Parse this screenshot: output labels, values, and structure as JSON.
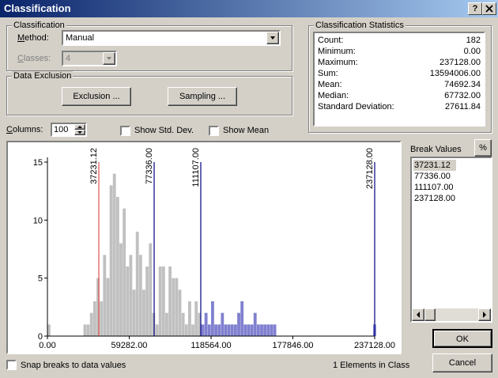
{
  "window": {
    "title": "Classification",
    "help_btn": "?",
    "close_btn": "X"
  },
  "classification": {
    "group_label": "Classification",
    "method_label": "Method:",
    "method_value": "Manual",
    "classes_label": "Classes:",
    "classes_value": "4"
  },
  "exclusion": {
    "group_label": "Data Exclusion",
    "exclusion_btn": "Exclusion ...",
    "sampling_btn": "Sampling ..."
  },
  "stats": {
    "group_label": "Classification Statistics",
    "rows": [
      {
        "label": "Count:",
        "value": "182"
      },
      {
        "label": "Minimum:",
        "value": "0.00"
      },
      {
        "label": "Maximum:",
        "value": "237128.00"
      },
      {
        "label": "Sum:",
        "value": "13594006.00"
      },
      {
        "label": "Mean:",
        "value": "74692.34"
      },
      {
        "label": "Median:",
        "value": "67732.00"
      },
      {
        "label": "Standard Deviation:",
        "value": "27611.84"
      }
    ]
  },
  "columns": {
    "label": "Columns:",
    "value": "100"
  },
  "show_std_dev": {
    "label": "Show Std. Dev.",
    "checked": false
  },
  "show_mean": {
    "label": "Show Mean",
    "checked": false
  },
  "break_values": {
    "label": "Break Values",
    "pct_btn": "%",
    "items": [
      "37231.12",
      "77336.00",
      "111107.00",
      "237128.00"
    ],
    "selected_index": 0
  },
  "ok_btn": "OK",
  "cancel_btn": "Cancel",
  "snap": {
    "label": "Snap breaks to data values",
    "checked": false
  },
  "elements_in_class": "1 Elements in Class",
  "chart_data": {
    "type": "bar",
    "xlim": [
      0,
      237128
    ],
    "ylim": [
      0,
      15
    ],
    "x_ticks": [
      "0.00",
      "59282.00",
      "118564.00",
      "177846.00",
      "237128.00"
    ],
    "y_ticks": [
      "0",
      "5",
      "10",
      "15"
    ],
    "bin_width": 2371.28,
    "bin_starts": [
      0,
      26086,
      28457,
      30828,
      33200,
      35571,
      37942,
      40313,
      42684,
      45055,
      47426,
      49797,
      52169,
      54540,
      56911,
      59282,
      61653,
      64024,
      66395,
      68766,
      71137,
      73508,
      75880,
      78251,
      80622,
      82993,
      85364,
      87735,
      90106,
      92477,
      94849,
      97220,
      99591,
      101962,
      104333,
      106704,
      109075,
      111446,
      113818,
      116189,
      118560,
      120931,
      123302,
      125673,
      128044,
      130415,
      132787,
      135158,
      137529,
      139900,
      142271,
      144642,
      147013,
      149384,
      151756,
      154127,
      156498,
      158869,
      161240,
      163611,
      235957
    ],
    "counts": [
      1,
      1,
      1,
      2,
      3,
      5,
      3,
      7,
      5,
      13,
      14,
      12,
      8,
      11,
      6,
      7,
      4,
      9,
      7,
      4,
      6,
      8,
      2,
      1,
      6,
      6,
      2,
      6,
      5,
      5,
      4,
      2,
      1,
      3,
      1,
      3,
      2,
      1,
      2,
      1,
      3,
      1,
      1,
      2,
      1,
      1,
      1,
      1,
      2,
      3,
      1,
      1,
      1,
      2,
      1,
      1,
      1,
      1,
      1,
      1,
      1
    ],
    "breaks": [
      37231.12,
      77336.0,
      111107.0,
      237128.0
    ],
    "break_labels": [
      "37231.12",
      "77336.00",
      "111107.00",
      "237128.00"
    ],
    "colors": {
      "bar": "#c0c0c0",
      "bar_in_class": "#8080d0",
      "first_break": "#e05050",
      "break": "#000080"
    }
  }
}
